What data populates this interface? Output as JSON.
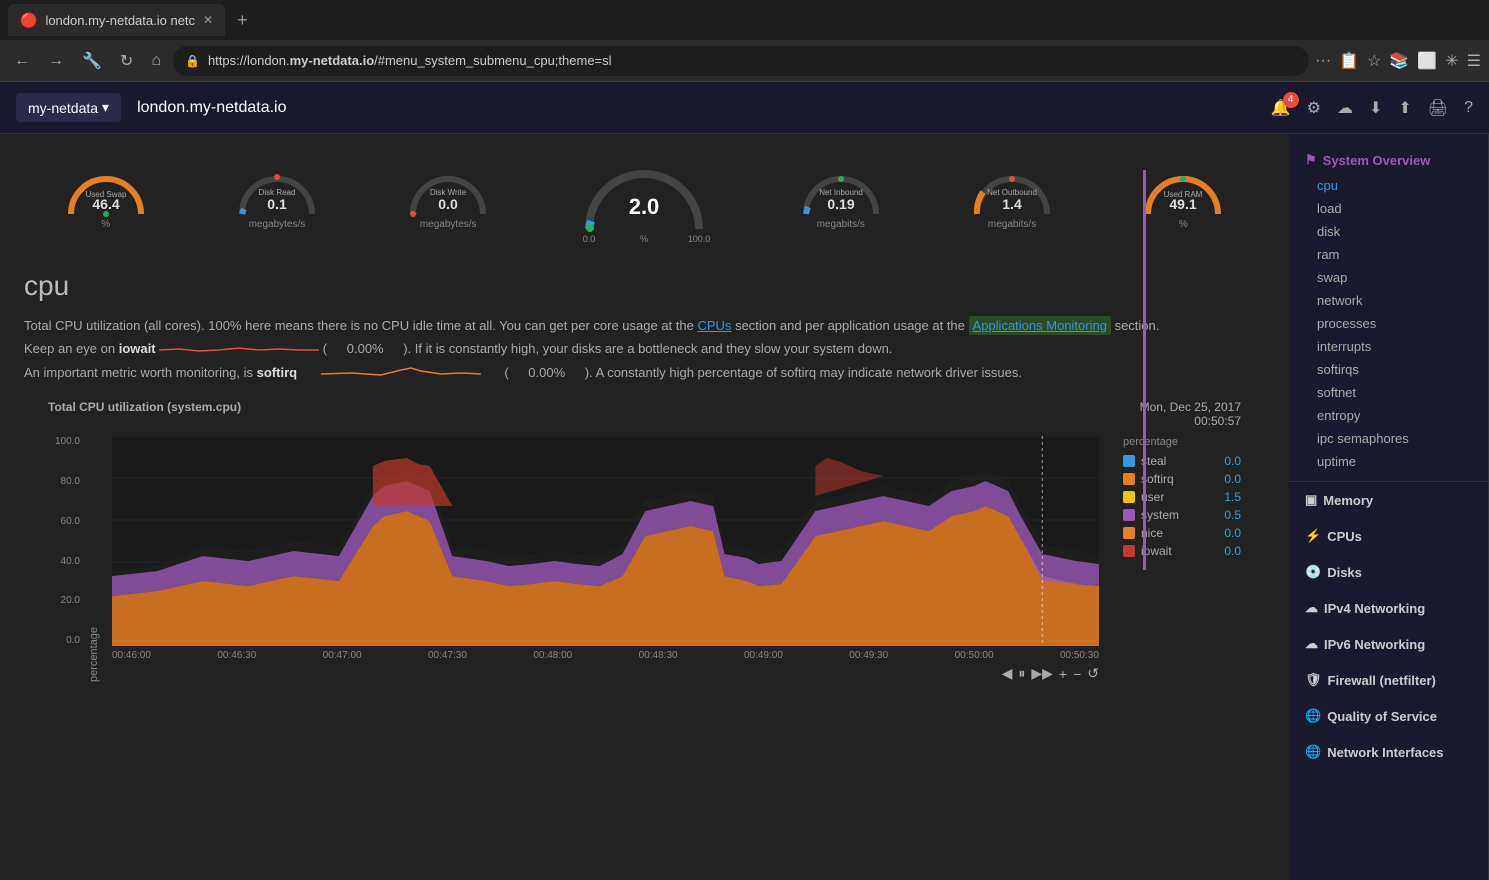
{
  "browser": {
    "tab_title": "london.my-netdata.io netc",
    "tab_icon": "🔴",
    "url": "https://london.my-netdata.io/#menu_system_submenu_cpu;theme=sl",
    "url_display": "https://london.",
    "url_bold": "my-netdata.io",
    "url_rest": "/#menu_system_submenu_cpu;theme=sl"
  },
  "app": {
    "brand": "my-netdata",
    "host": "london.my-netdata.io",
    "notification_count": "4"
  },
  "gauges": [
    {
      "id": "used-swap",
      "label": "Used Swap",
      "value": "46.4",
      "unit": "%",
      "color": "#e67e22",
      "type": "arc",
      "dot_color": "#27ae60"
    },
    {
      "id": "disk-read",
      "label": "Disk Read",
      "value": "0.1",
      "unit": "megabytes/s",
      "color": "#3498db",
      "type": "arc",
      "dot_color": "#e74c3c"
    },
    {
      "id": "disk-write",
      "label": "Disk Write",
      "value": "0.0",
      "unit": "megabytes/s",
      "color": "#3498db",
      "type": "arc",
      "dot_color": "#e74c3c"
    },
    {
      "id": "cpu-total",
      "label": "",
      "value": "2.0",
      "unit": "%",
      "color": "#3498db",
      "type": "big-arc",
      "dot_color": "#27ae60",
      "min": "0.0",
      "max": "100.0"
    },
    {
      "id": "net-inbound",
      "label": "Net Inbound",
      "value": "0.19",
      "unit": "megabits/s",
      "color": "#3498db",
      "type": "arc",
      "dot_color": "#27ae60"
    },
    {
      "id": "net-outbound",
      "label": "Net Outbound",
      "value": "1.4",
      "unit": "megabits/s",
      "color": "#e67e22",
      "type": "arc",
      "dot_color": "#e74c3c"
    },
    {
      "id": "used-ram",
      "label": "Used RAM",
      "value": "49.1",
      "unit": "%",
      "color": "#e67e22",
      "type": "arc",
      "dot_color": "#27ae60"
    }
  ],
  "cpu": {
    "section_title": "cpu",
    "description_1": "Total CPU utilization (all cores). 100% here means there is no CPU idle time at all. You can get per core usage at the",
    "cpus_link": "CPUs",
    "description_2": "section and per application usage at the",
    "app_monitoring_link": "Applications Monitoring",
    "description_3": "section.",
    "iowait_label": "iowait",
    "iowait_value": "0.00%",
    "iowait_desc": "). If it is constantly high, your disks are a bottleneck and they slow your system down.",
    "softirq_label": "softirq",
    "softirq_value": "0.00%",
    "softirq_desc": "). A constantly high percentage of softirq may indicate network driver issues.",
    "chart_title": "Total CPU utilization (system.cpu)",
    "timestamp_date": "Mon, Dec 25, 2017",
    "timestamp_time": "00:50:57",
    "y_axis_label": "percentage",
    "y_axis_values": [
      "100.0",
      "80.0",
      "60.0",
      "40.0",
      "20.0",
      "0.0"
    ],
    "x_axis_values": [
      "00:46:00",
      "00:46:30",
      "00:47:00",
      "00:47:30",
      "00:48:00",
      "00:48:30",
      "00:49:00",
      "00:49:30",
      "00:50:00",
      "00:50:30"
    ],
    "legend_label": "percentage",
    "legend_items": [
      {
        "name": "steal",
        "color": "#3498db",
        "value": "0.0"
      },
      {
        "name": "softirq",
        "color": "#e67e22",
        "value": "0.0"
      },
      {
        "name": "user",
        "color": "#f1c40f",
        "value": "1.5"
      },
      {
        "name": "system",
        "color": "#9b59b6",
        "value": "0.5"
      },
      {
        "name": "nice",
        "color": "#e67e22",
        "value": "0.0"
      },
      {
        "name": "iowait",
        "color": "#c0392b",
        "value": "0.0"
      }
    ]
  },
  "sidebar": {
    "system_overview_label": "System Overview",
    "items_system": [
      {
        "id": "cpu",
        "label": "cpu",
        "active": true
      },
      {
        "id": "load",
        "label": "load"
      },
      {
        "id": "disk",
        "label": "disk"
      },
      {
        "id": "ram",
        "label": "ram"
      },
      {
        "id": "swap",
        "label": "swap"
      },
      {
        "id": "network",
        "label": "network"
      },
      {
        "id": "processes",
        "label": "processes"
      },
      {
        "id": "interrupts",
        "label": "interrupts"
      },
      {
        "id": "softirqs",
        "label": "softirqs"
      },
      {
        "id": "softnet",
        "label": "softnet"
      },
      {
        "id": "entropy",
        "label": "entropy"
      },
      {
        "id": "ipc-semaphores",
        "label": "ipc semaphores"
      },
      {
        "id": "uptime",
        "label": "uptime"
      }
    ],
    "memory_label": "Memory",
    "cpus_label": "CPUs",
    "disks_label": "Disks",
    "ipv4_label": "IPv4 Networking",
    "ipv6_label": "IPv6 Networking",
    "firewall_label": "Firewall (netfilter)",
    "qos_label": "Quality of Service",
    "network_iface_label": "Network Interfaces"
  }
}
